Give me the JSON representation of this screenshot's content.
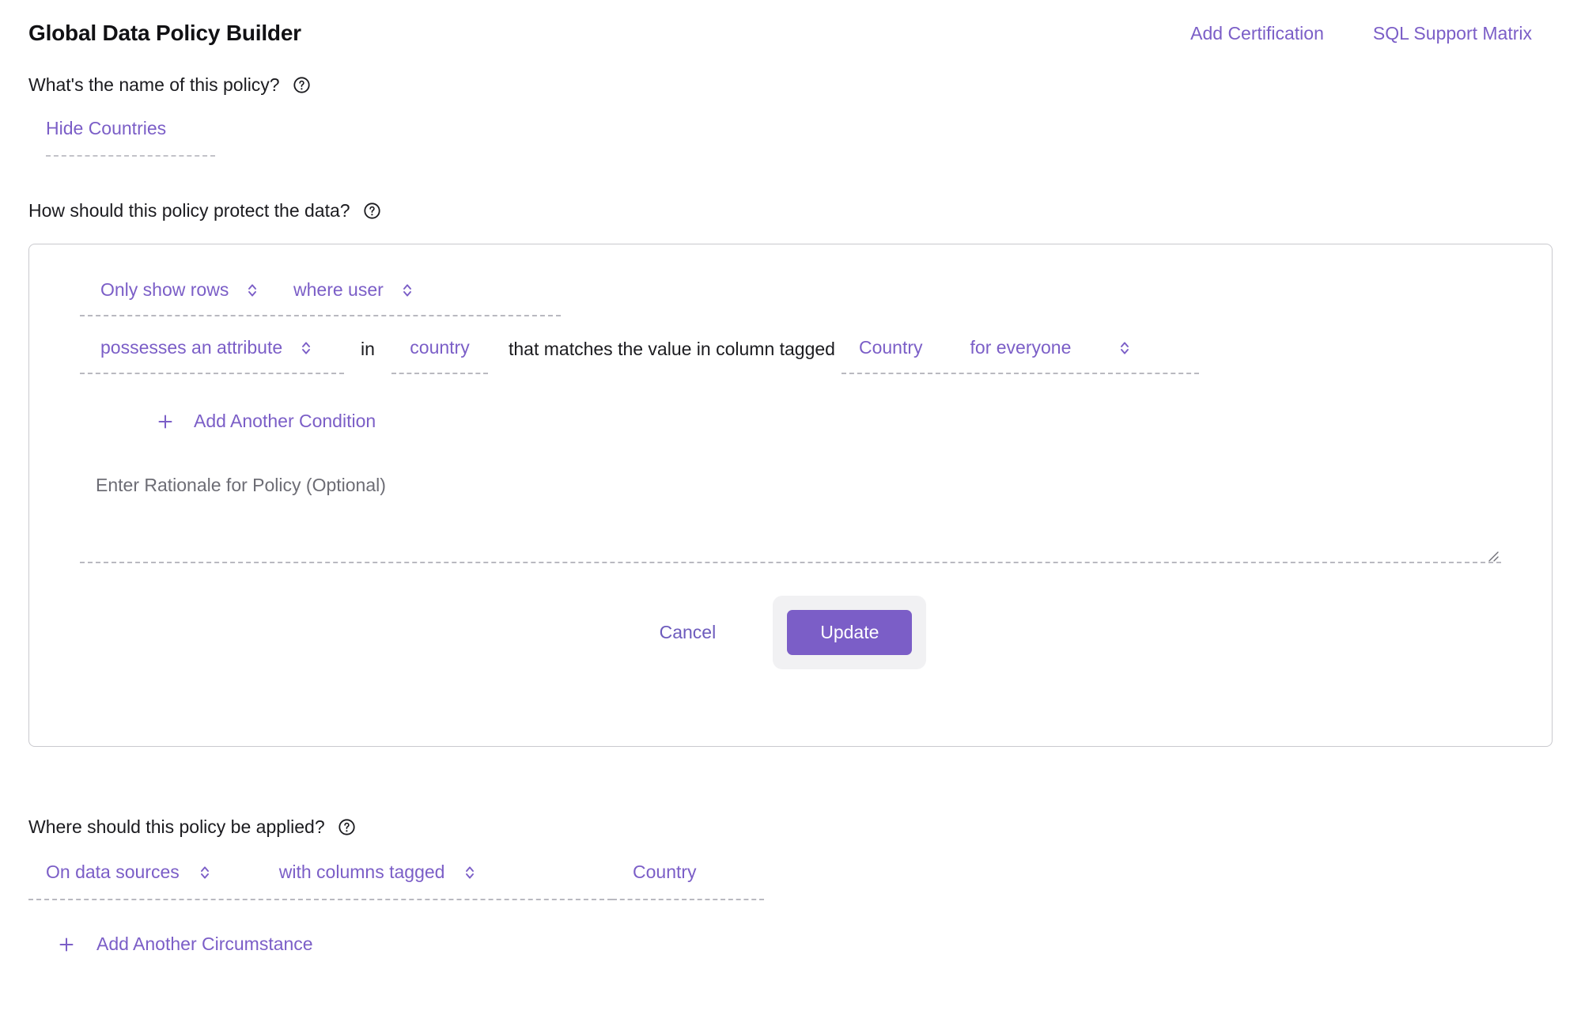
{
  "header": {
    "title": "Global Data Policy Builder",
    "links": [
      {
        "label": "Add Certification",
        "name": "add-certification-link"
      },
      {
        "label": "SQL Support Matrix",
        "name": "sql-support-matrix-link"
      }
    ]
  },
  "colors": {
    "accent_purple": "#7b5ec7",
    "link_purple": "#6d5bbd",
    "dashed_gray": "#b9b9c0",
    "card_border": "#c9c9ce",
    "text_dark": "#1b1b1f",
    "placeholder_gray": "#6d6d75",
    "button_ring": "#f1f1f3"
  },
  "sections": {
    "name": {
      "question": "What's the name of this policy?",
      "help_icon": "question-circle-icon",
      "value": "Hide Countries"
    },
    "protect": {
      "question": "How should this policy protect the data?",
      "help_icon": "question-circle-icon"
    },
    "applied": {
      "question": "Where should this policy be applied?",
      "help_icon": "question-circle-icon"
    }
  },
  "condition": {
    "row1": {
      "action": "Only show rows",
      "action_spinner_icon": "sort-updown-icon",
      "subject": "where user",
      "subject_spinner_icon": "sort-updown-icon"
    },
    "row2": {
      "predicate": "possesses an attribute",
      "predicate_spinner_icon": "sort-updown-icon",
      "in_text": "in",
      "attribute": "country",
      "match_text": "that matches the value in column tagged",
      "tag": "Country",
      "scope": "for everyone",
      "scope_spinner_icon": "sort-updown-icon"
    },
    "add_condition": {
      "icon": "plus-icon",
      "label": "Add Another Condition"
    },
    "rationale": {
      "placeholder": "Enter Rationale for Policy (Optional)",
      "value": "",
      "resize_handle_icon": "resize-grip-icon"
    },
    "actions": {
      "cancel_label": "Cancel",
      "update_label": "Update"
    }
  },
  "circumstance": {
    "target": "On data sources",
    "target_spinner_icon": "sort-updown-icon",
    "filter": "with columns tagged",
    "filter_spinner_icon": "sort-updown-icon",
    "tag": "Country",
    "add_circumstance": {
      "icon": "plus-icon",
      "label": "Add Another Circumstance"
    }
  }
}
